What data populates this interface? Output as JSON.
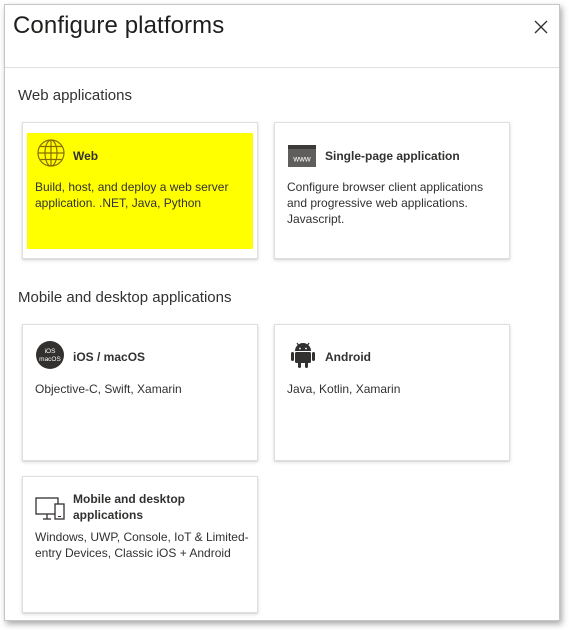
{
  "panel": {
    "title": "Configure platforms",
    "close_icon": "close-icon"
  },
  "sections": {
    "web": "Web applications",
    "mobile": "Mobile and desktop applications"
  },
  "cards": {
    "web": {
      "title": "Web",
      "description": "Build, host, and deploy a web server application. .NET, Java, Python",
      "icon": "globe-icon",
      "highlight_color": "#ffff00"
    },
    "spa": {
      "title": "Single-page application",
      "description": "Configure browser client applications and progressive web applications. Javascript.",
      "icon": "www-browser-icon",
      "icon_text": "www"
    },
    "ios": {
      "title": "iOS / macOS",
      "description": "Objective-C, Swift, Xamarin",
      "icon": "ios-macos-icon",
      "icon_text_top": "iOS",
      "icon_text_bottom": "macOS"
    },
    "android": {
      "title": "Android",
      "description": "Java, Kotlin, Xamarin",
      "icon": "android-icon"
    },
    "desktop": {
      "title": "Mobile and desktop applications",
      "description": "Windows, UWP, Console, IoT & Limited-entry Devices, Classic iOS + Android",
      "icon": "desktop-mobile-icon"
    }
  }
}
